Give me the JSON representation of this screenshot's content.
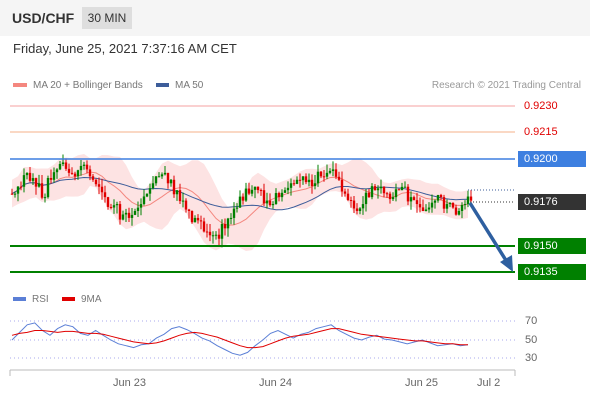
{
  "header": {
    "pair": "USD/CHF",
    "timeframe": "30 MIN",
    "datetime": "Friday, June 25, 2021 7:37:16 AM CET",
    "credit": "Research © 2021 Trading Central"
  },
  "legend": {
    "ma20_label": "MA 20 + Bollinger Bands",
    "ma50_label": "MA 50",
    "ma20_color": "#f4877f",
    "ma50_color": "#3d5d9a"
  },
  "rsi_legend": {
    "rsi_label": "RSI",
    "ma9_label": "9MA",
    "rsi_color": "#5b7fd6",
    "ma9_color": "#e00000"
  },
  "levels": {
    "r2": "0.9230",
    "r1": "0.9215",
    "pivot": "0.9200",
    "last": "0.9176",
    "s1": "0.9150",
    "s2": "0.9135"
  },
  "rsi_levels": [
    "70",
    "50",
    "30"
  ],
  "x_ticks": [
    "Jun 23",
    "Jun 24",
    "Jun 25",
    "Jul 2"
  ],
  "colors": {
    "resistance": "#e00000",
    "pivot_line": "#3d7fe0",
    "support": "#008000",
    "last_tag": "#333333",
    "arrow": "#2e5fa0",
    "candle_up": "#008000",
    "candle_down": "#e00000",
    "band_fill": "#fde3e3"
  },
  "chart_data": [
    {
      "type": "candlestick",
      "title": "",
      "ylim": [
        0.9127,
        0.9238
      ],
      "grid": false,
      "legend_position": "top-left",
      "x_tick_labels": [
        "Jun 23",
        "Jun 24",
        "Jun 25",
        "Jul 2"
      ],
      "horizontal_levels": [
        0.923,
        0.9215,
        0.92,
        0.9176,
        0.915,
        0.9135
      ],
      "close_series": [
        0.918,
        0.9184,
        0.9192,
        0.9189,
        0.9186,
        0.9178,
        0.9188,
        0.9194,
        0.9198,
        0.9192,
        0.919,
        0.9196,
        0.9194,
        0.9188,
        0.9184,
        0.9178,
        0.9172,
        0.9174,
        0.9168,
        0.9166,
        0.917,
        0.9174,
        0.918,
        0.9186,
        0.919,
        0.9192,
        0.9188,
        0.9182,
        0.9176,
        0.917,
        0.9166,
        0.9164,
        0.9158,
        0.9156,
        0.9154,
        0.916,
        0.9166,
        0.9172,
        0.9176,
        0.918,
        0.9184,
        0.9182,
        0.9176,
        0.9174,
        0.9178,
        0.9182,
        0.9186,
        0.9188,
        0.919,
        0.9188,
        0.9186,
        0.919,
        0.9192,
        0.9194,
        0.9188,
        0.918,
        0.9176,
        0.917,
        0.9174,
        0.9178,
        0.9182,
        0.9184,
        0.918,
        0.9178,
        0.9182,
        0.9184,
        0.9178,
        0.9174,
        0.917,
        0.9172,
        0.9176,
        0.9178,
        0.9174,
        0.9172,
        0.917,
        0.9174,
        0.9176
      ],
      "series": [
        {
          "name": "MA 20 + Bollinger Bands"
        },
        {
          "name": "MA 50"
        }
      ]
    },
    {
      "type": "line",
      "title": "",
      "ylim": [
        20,
        80
      ],
      "y_ticks": [
        70,
        50,
        30
      ],
      "series": [
        {
          "name": "RSI",
          "values": [
            50,
            58,
            66,
            68,
            60,
            55,
            62,
            66,
            64,
            57,
            55,
            60,
            55,
            50,
            46,
            44,
            42,
            45,
            46,
            52,
            56,
            62,
            64,
            61,
            57,
            52,
            49,
            44,
            40,
            36,
            34,
            37,
            44,
            50,
            57,
            60,
            56,
            52,
            56,
            58,
            62,
            64,
            66,
            60,
            56,
            52,
            50,
            53,
            55,
            51,
            50,
            48,
            46,
            48,
            50,
            47,
            44,
            45,
            46,
            44,
            45
          ]
        },
        {
          "name": "9MA",
          "values": [
            55,
            57,
            58,
            60,
            60,
            59,
            58,
            59,
            59,
            58,
            57,
            57,
            56,
            54,
            52,
            50,
            48,
            47,
            46,
            47,
            49,
            52,
            55,
            57,
            58,
            57,
            55,
            53,
            50,
            47,
            44,
            42,
            42,
            43,
            46,
            49,
            52,
            54,
            55,
            56,
            58,
            60,
            62,
            62,
            60,
            58,
            56,
            55,
            54,
            53,
            52,
            51,
            50,
            49,
            49,
            48,
            47,
            46,
            46,
            45,
            45
          ]
        }
      ]
    }
  ]
}
